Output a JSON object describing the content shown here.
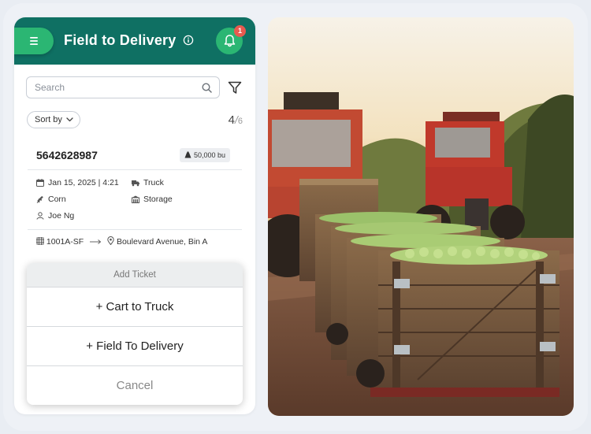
{
  "header": {
    "title": "Field to Delivery",
    "notification_count": "1"
  },
  "search": {
    "placeholder": "Search"
  },
  "sort": {
    "label": "Sort by"
  },
  "count": {
    "current": "4",
    "total": "6"
  },
  "ticket": {
    "id": "5642628987",
    "volume": "50,000 bu",
    "datetime": "Jan 15, 2025 | 4:21",
    "vehicle": "Truck",
    "crop": "Corn",
    "destination_type": "Storage",
    "driver": "Joe Ng",
    "origin": "1001A-SF",
    "destination": "Boulevard Avenue, Bin A"
  },
  "sheet": {
    "title": "Add Ticket",
    "options": [
      "+ Cart to Truck",
      "+ Field To Delivery"
    ],
    "cancel": "Cancel"
  },
  "colors": {
    "header_bg": "#0f7063",
    "accent_green": "#2bb673",
    "badge_red": "#e85a4f"
  },
  "icons": [
    "menu-icon",
    "info-icon",
    "bell-icon",
    "search-icon",
    "filter-icon",
    "chevron-down-icon",
    "weight-icon",
    "calendar-icon",
    "truck-icon",
    "crop-icon",
    "storage-icon",
    "person-icon",
    "field-icon",
    "arrow-right-icon",
    "location-pin-icon"
  ]
}
